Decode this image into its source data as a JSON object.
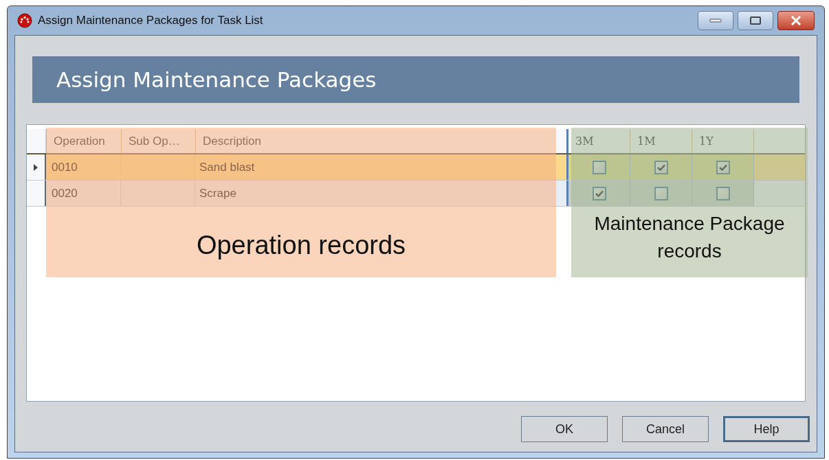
{
  "window": {
    "title": "Assign Maintenance Packages for Task List"
  },
  "banner": {
    "title": "Assign Maintenance Packages"
  },
  "grid": {
    "columns": [
      "Operation",
      "Sub Op…",
      "Description"
    ],
    "package_columns": [
      "3M",
      "1M",
      "1Y"
    ],
    "rows": [
      {
        "operation": "0010",
        "description": "Sand blast",
        "selected": true,
        "packages": [
          {
            "checked": false
          },
          {
            "checked": true
          },
          {
            "checked": true
          }
        ]
      },
      {
        "operation": "0020",
        "description": "Scrape",
        "selected": false,
        "packages": [
          {
            "checked": true
          },
          {
            "checked": false
          },
          {
            "checked": false
          }
        ]
      }
    ]
  },
  "annotations": [
    {
      "kind": "operation",
      "label": "Operation records"
    },
    {
      "kind": "package",
      "label": "Maintenance Package records"
    }
  ],
  "buttons": [
    {
      "label": "OK",
      "focused": false
    },
    {
      "label": "Cancel",
      "focused": false
    },
    {
      "label": "Help",
      "focused": true
    }
  ]
}
